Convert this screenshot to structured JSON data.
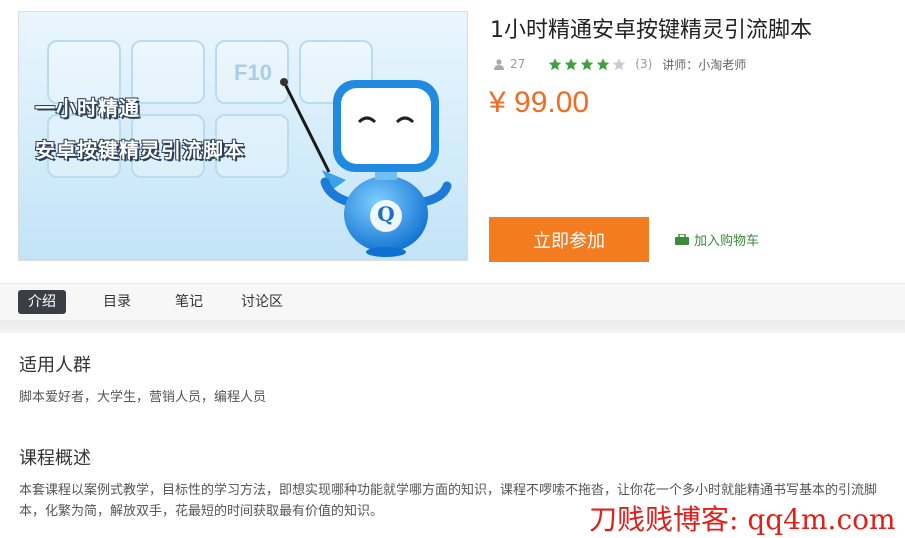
{
  "course": {
    "cover_text_line1": "一小时精通",
    "cover_text_line2": "安卓按键精灵引流脚本",
    "cover_key_label": "F10",
    "cover_robot_letter": "Q",
    "title": "1小时精通安卓按键精灵引流脚本",
    "students": "27",
    "rating_stars": 4,
    "rating_max": 5,
    "rating_count": "(3)",
    "teacher": "讲师：小淘老师",
    "price": "¥ 99.00",
    "join_label": "立即参加",
    "cart_label": "加入购物车"
  },
  "tabs": [
    {
      "label": "介绍",
      "active": true
    },
    {
      "label": "目录",
      "active": false
    },
    {
      "label": "笔记",
      "active": false
    },
    {
      "label": "讨论区",
      "active": false
    }
  ],
  "sections": {
    "audience_title": "适用人群",
    "audience_text": "脚本爱好者，大学生，营销人员，编程人员",
    "overview_title": "课程概述",
    "overview_text": "本套课程以案例式教学，目标性的学习方法，即想实现哪种功能就学哪方面的知识，课程不啰嗦不拖沓，让你花一个多小时就能精通书写基本的引流脚本，化繁为简，解放双手，花最短的时间获取最有价值的知识。"
  },
  "watermark": "刀贱贱博客: qq4m.com",
  "colors": {
    "price": "#f26b22",
    "join_button": "#f47c20",
    "star_filled": "#3aa33a",
    "star_empty": "#cccccc",
    "active_tab": "#3b3f45",
    "watermark": "#e0201c"
  },
  "icons": {
    "students": "person-icon",
    "cart": "cart-icon",
    "rating": "star-icon"
  }
}
